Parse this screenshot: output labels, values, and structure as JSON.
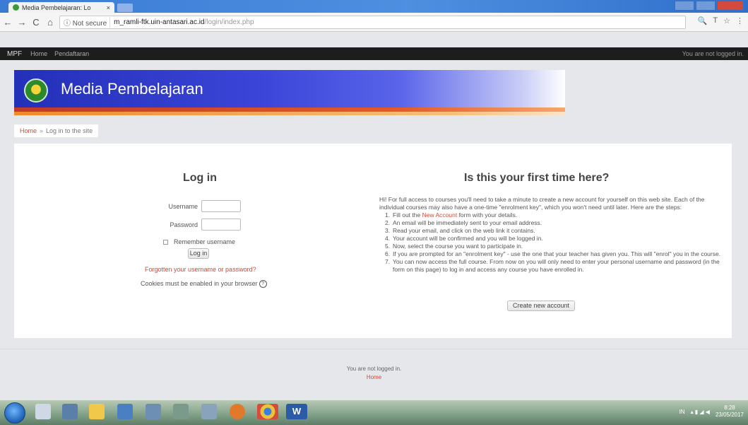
{
  "browser": {
    "tab_title": "Media Pembelajaran: Lo",
    "tab_close": "×",
    "security_label": "ⓘ Not secure",
    "url_host": "m_ramli-ftk.uin-antasari.ac.id",
    "url_path": "/login/index.php",
    "nav_back": "←",
    "nav_forward": "→",
    "nav_reload": "C",
    "nav_home": "⌂",
    "toolbar_icons": [
      "🔍",
      "T",
      "☆",
      "⋮"
    ]
  },
  "navbar": {
    "brand": "MPF",
    "items": [
      "Home",
      "Pendaftaran"
    ],
    "login_status": "You are not logged in."
  },
  "header": {
    "site_title": "Media Pembelajaran"
  },
  "breadcrumb": {
    "home": "Home",
    "separator": "»",
    "current": "Log in to the site"
  },
  "login": {
    "title": "Log in",
    "username_label": "Username",
    "password_label": "Password",
    "remember_label": "Remember username",
    "login_button": "Log in",
    "forgot_link": "Forgotten your username or password?",
    "cookies_text": "Cookies must be enabled in your browser",
    "help_icon": "?"
  },
  "signup": {
    "title": "Is this your first time here?",
    "intro": "Hi! For full access to courses you'll need to take a minute to create a new account for yourself on this web site. Each of the individual courses may also have a one-time \"enrolment key\", which you won't need until later. Here are the steps:",
    "steps": [
      {
        "n": "1.",
        "text_a": "Fill out the ",
        "link": "New Account",
        "text_b": " form with your details."
      },
      {
        "n": "2.",
        "text_a": "An email will be immediately sent to your email address.",
        "link": "",
        "text_b": ""
      },
      {
        "n": "3.",
        "text_a": "Read your email, and click on the web link it contains.",
        "link": "",
        "text_b": ""
      },
      {
        "n": "4.",
        "text_a": "Your account will be confirmed and you will be logged in.",
        "link": "",
        "text_b": ""
      },
      {
        "n": "5.",
        "text_a": "Now, select the course you want to participate in.",
        "link": "",
        "text_b": ""
      },
      {
        "n": "6.",
        "text_a": "If you are prompted for an \"enrolment key\" - use the one that your teacher has given you. This will \"enrol\" you in the course.",
        "link": "",
        "text_b": ""
      },
      {
        "n": "7.",
        "text_a": "You can now access the full course. From now on you will only need to enter your personal username and password (in the form on this page) to log in and access any course you have enrolled in.",
        "link": "",
        "text_b": ""
      }
    ],
    "create_button": "Create new account"
  },
  "footer": {
    "status": "You are not logged in.",
    "home_link": "Home"
  },
  "taskbar": {
    "tray_lang": "IN",
    "time": "8:28",
    "date": "23/05/2017"
  },
  "colors": {
    "link": "#d14836",
    "banner_blue": "#2330b8",
    "navbar": "#1d1d1d"
  }
}
